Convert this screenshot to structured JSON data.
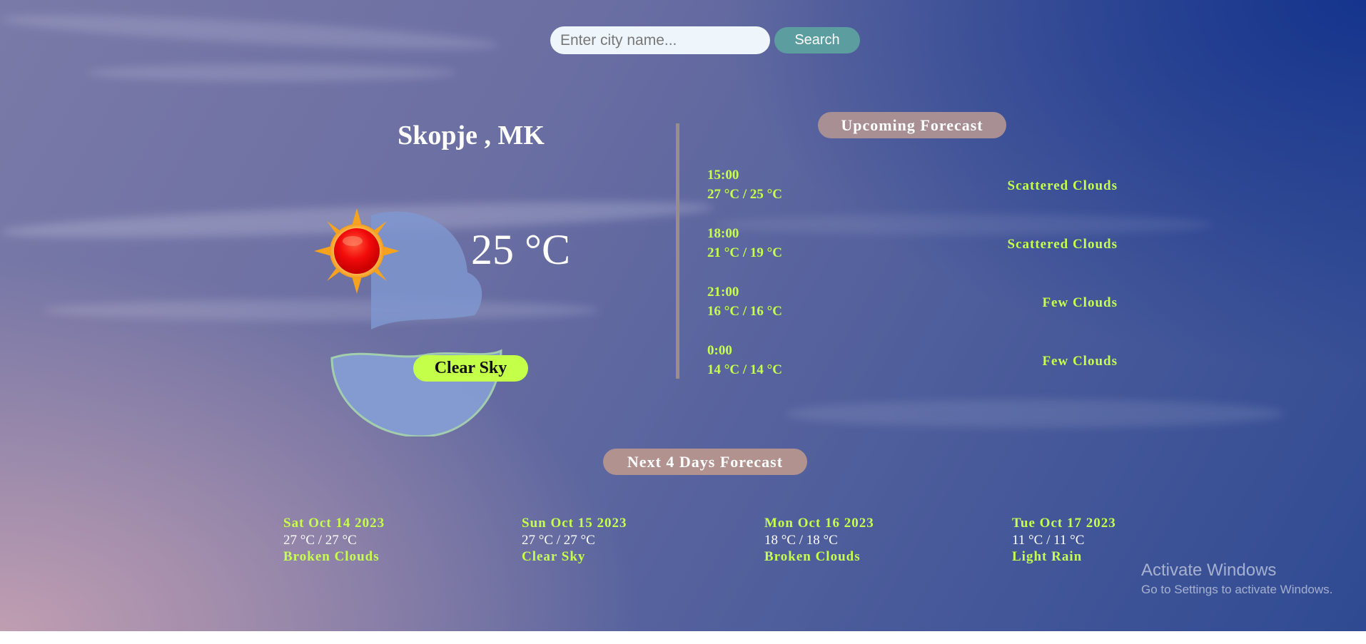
{
  "search": {
    "placeholder": "Enter city name...",
    "value": "",
    "button_label": "Search"
  },
  "current": {
    "city": "Skopje , MK",
    "temperature": "25 °C",
    "condition": "Clear Sky",
    "icon": "sun-cloud-icon"
  },
  "upcoming": {
    "title": "Upcoming Forecast",
    "items": [
      {
        "time": "15:00",
        "temps": "27 °C / 25 °C",
        "desc": "Scattered Clouds"
      },
      {
        "time": "18:00",
        "temps": "21 °C / 19 °C",
        "desc": "Scattered Clouds"
      },
      {
        "time": "21:00",
        "temps": "16 °C / 16 °C",
        "desc": "Few Clouds"
      },
      {
        "time": "0:00",
        "temps": "14 °C / 14 °C",
        "desc": "Few Clouds"
      }
    ]
  },
  "daily": {
    "title": "Next 4 Days Forecast",
    "days": [
      {
        "date": "Sat Oct 14 2023",
        "temps": "27 °C / 27 °C",
        "desc": "Broken Clouds"
      },
      {
        "date": "Sun Oct 15 2023",
        "temps": "27 °C / 27 °C",
        "desc": "Clear Sky"
      },
      {
        "date": "Mon Oct 16 2023",
        "temps": "18 °C / 18 °C",
        "desc": "Broken Clouds"
      },
      {
        "date": "Tue Oct 17 2023",
        "temps": "11 °C / 11 °C",
        "desc": "Light Rain"
      }
    ]
  },
  "watermark": {
    "title": "Activate Windows",
    "subtitle": "Go to Settings to activate Windows."
  },
  "colors": {
    "accent_green": "#c6ff4e",
    "badge_green": "#c4ff4a",
    "search_button": "#5c9ea0",
    "pill_background": "#a88f93"
  }
}
